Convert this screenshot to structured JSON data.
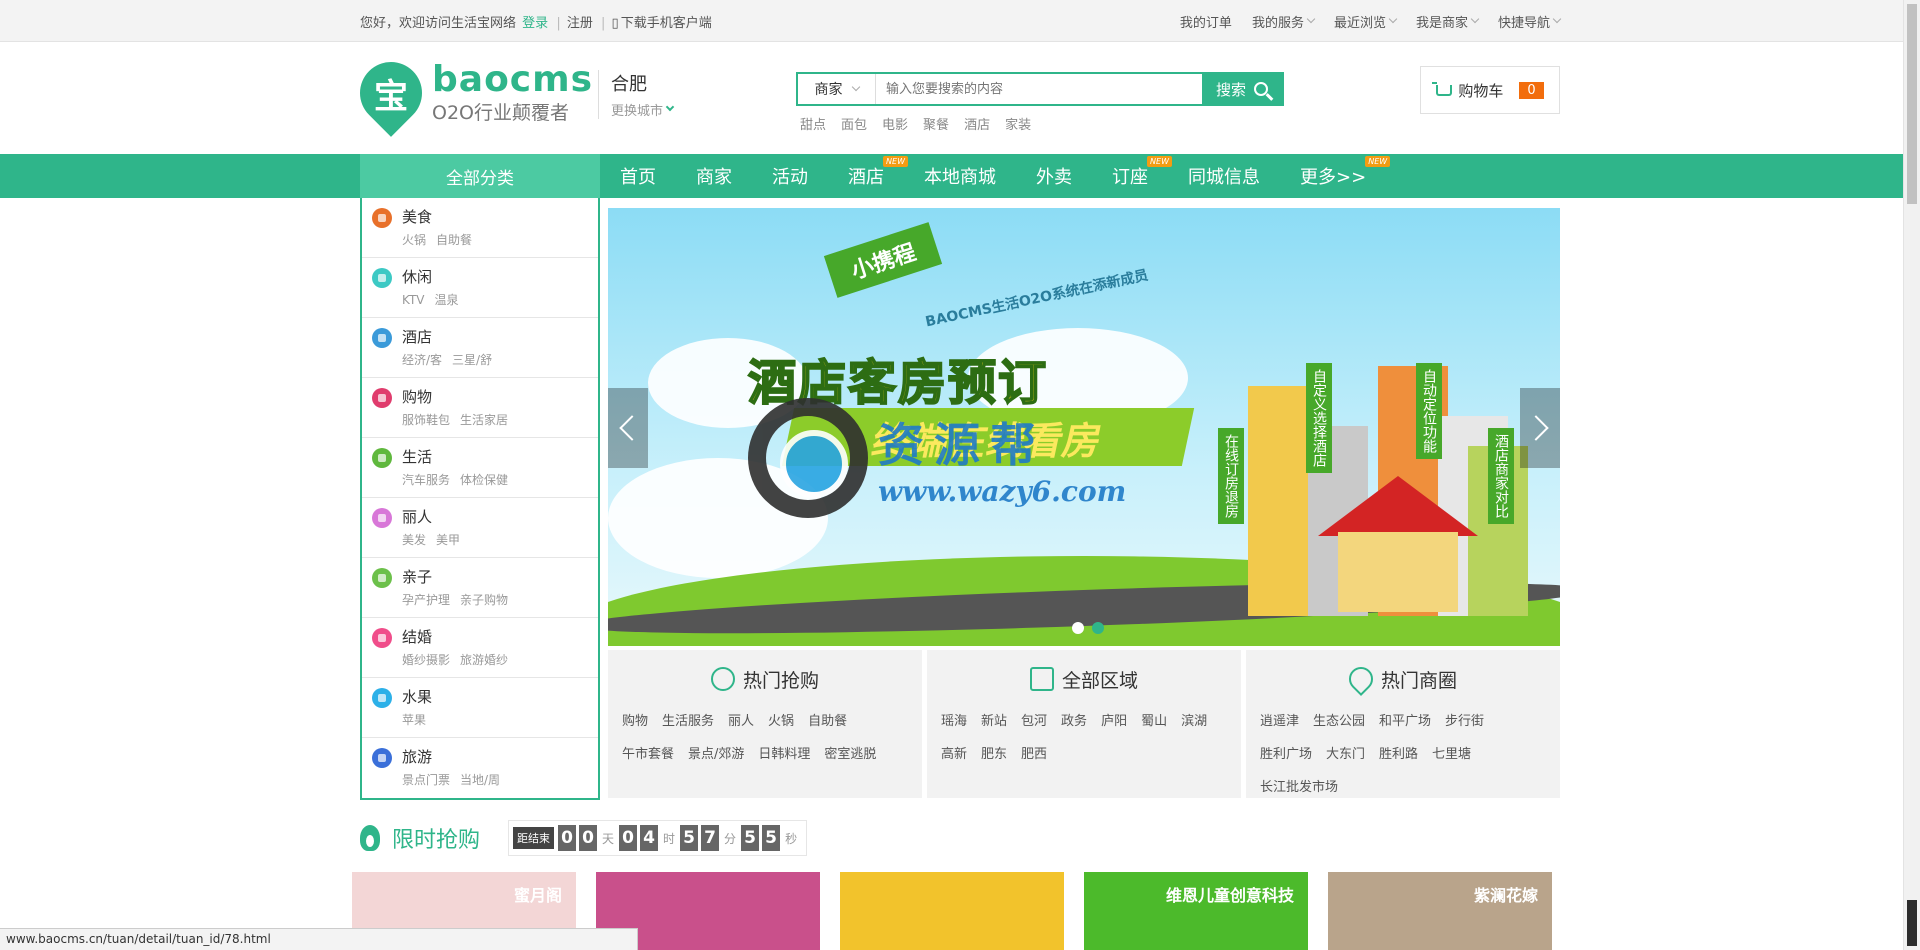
{
  "topbar": {
    "welcome": "您好，欢迎访问生活宝网络",
    "login": "登录",
    "register": "注册",
    "download": "下载手机客户端",
    "links": [
      "我的订单",
      "我的服务",
      "最近浏览",
      "我是商家",
      "快捷导航"
    ]
  },
  "logo": {
    "icon_char": "宝",
    "name": "baocms",
    "slogan": "O2O行业颠覆者"
  },
  "city": {
    "name": "合肥",
    "switch": "更换城市"
  },
  "search": {
    "type": "商家",
    "placeholder": "输入您要搜索的内容",
    "button": "搜索",
    "hotwords": [
      "甜点",
      "面包",
      "电影",
      "聚餐",
      "酒店",
      "家装"
    ]
  },
  "cart": {
    "label": "购物车",
    "count": "0"
  },
  "nav": {
    "all": "全部分类",
    "items": [
      {
        "label": "首页",
        "new": ""
      },
      {
        "label": "商家",
        "new": ""
      },
      {
        "label": "活动",
        "new": ""
      },
      {
        "label": "酒店",
        "new": "NEW"
      },
      {
        "label": "本地商城",
        "new": ""
      },
      {
        "label": "外卖",
        "new": ""
      },
      {
        "label": "订座",
        "new": "NEW"
      },
      {
        "label": "同城信息",
        "new": ""
      },
      {
        "label": "更多>>",
        "new": "NEW"
      }
    ]
  },
  "categories": [
    {
      "title": "美食",
      "subs": [
        "火锅",
        "自助餐"
      ],
      "color": "#e8702a"
    },
    {
      "title": "休闲",
      "subs": [
        "KTV",
        "温泉"
      ],
      "color": "#3cc9c4"
    },
    {
      "title": "酒店",
      "subs": [
        "经济/客",
        "三星/舒"
      ],
      "color": "#3a9ad9"
    },
    {
      "title": "购物",
      "subs": [
        "服饰鞋包",
        "生活家居"
      ],
      "color": "#e03c6d"
    },
    {
      "title": "生活",
      "subs": [
        "汽车服务",
        "体检保健"
      ],
      "color": "#5fb83d"
    },
    {
      "title": "丽人",
      "subs": [
        "美发",
        "美甲"
      ],
      "color": "#d877d8"
    },
    {
      "title": "亲子",
      "subs": [
        "孕产护理",
        "亲子购物"
      ],
      "color": "#6cc04a"
    },
    {
      "title": "结婚",
      "subs": [
        "婚纱摄影",
        "旅游婚纱"
      ],
      "color": "#f04d8a"
    },
    {
      "title": "水果",
      "subs": [
        "苹果"
      ],
      "color": "#2cb0e8"
    },
    {
      "title": "旅游",
      "subs": [
        "景点门票",
        "当地/周"
      ],
      "color": "#3a6fd9"
    }
  ],
  "banner": {
    "ribbon": "小携程",
    "subtitle": "BAOCMS生活O2O系统在添新成员",
    "title1": "酒店客房预订",
    "title2": "终端在线看房",
    "tags": [
      "在线订房退房",
      "自定义选择酒店",
      "自动定位功能",
      "酒店商家对比"
    ],
    "watermark_cn": "资源帮",
    "watermark_en": "www.wazy6.com"
  },
  "panels": [
    {
      "title": "热门抢购",
      "icon": "clock-icon",
      "links": [
        "购物",
        "生活服务",
        "丽人",
        "火锅",
        "自助餐",
        "午市套餐",
        "景点/郊游",
        "日韩料理",
        "密室逃脱"
      ]
    },
    {
      "title": "全部区域",
      "icon": "map-icon",
      "links": [
        "瑶海",
        "新站",
        "包河",
        "政务",
        "庐阳",
        "蜀山",
        "滨湖",
        "高新",
        "肥东",
        "肥西"
      ]
    },
    {
      "title": "热门商圈",
      "icon": "location-icon",
      "links": [
        "逍遥津",
        "生态公园",
        "和平广场",
        "步行街",
        "胜利广场",
        "大东门",
        "胜利路",
        "七里塘",
        "长江批发市场"
      ]
    }
  ],
  "flash": {
    "title": "限时抢购",
    "label": "距结束",
    "days": [
      "0",
      "0"
    ],
    "day_unit": "天",
    "hours": [
      "0",
      "4"
    ],
    "hour_unit": "时",
    "minutes": [
      "5",
      "7"
    ],
    "minute_unit": "分",
    "seconds": [
      "5",
      "5"
    ],
    "second_unit": "秒"
  },
  "products": [
    {
      "caption": "蜜月阁",
      "color": "#f3d6d6"
    },
    {
      "caption": "",
      "color": "#c9508b"
    },
    {
      "caption": "",
      "color": "#f2c32c"
    },
    {
      "caption": "维恩儿童创意科技",
      "color": "#4cba2b"
    },
    {
      "caption": "紫澜花嫁",
      "color": "#b9a48b"
    }
  ],
  "status_url": "www.baocms.cn/tuan/detail/tuan_id/78.html"
}
